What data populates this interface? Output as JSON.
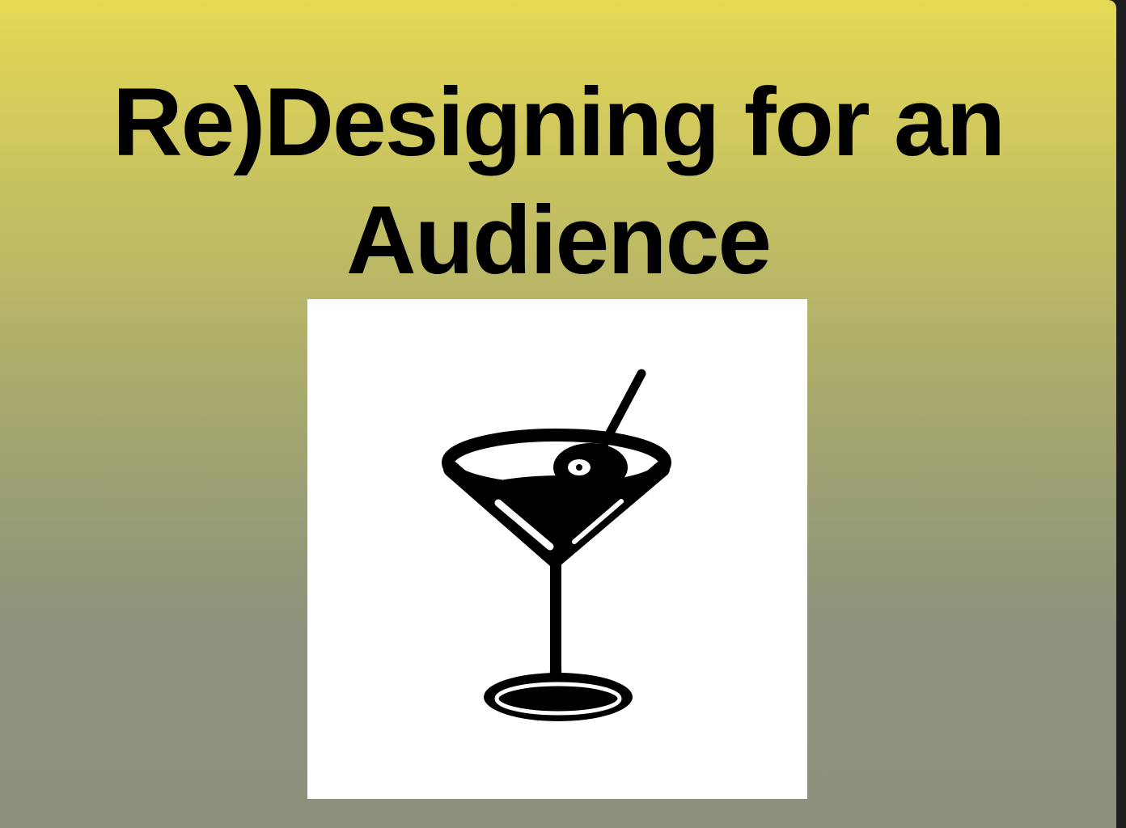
{
  "slide": {
    "title_line_1": "Re)Designing for an",
    "title_line_2": "Audience",
    "background_gradient": [
      "#e6d954",
      "#8b917c"
    ],
    "image": {
      "icon": "martini-glass-icon",
      "background": "#ffffff",
      "ink": "#000000"
    }
  }
}
